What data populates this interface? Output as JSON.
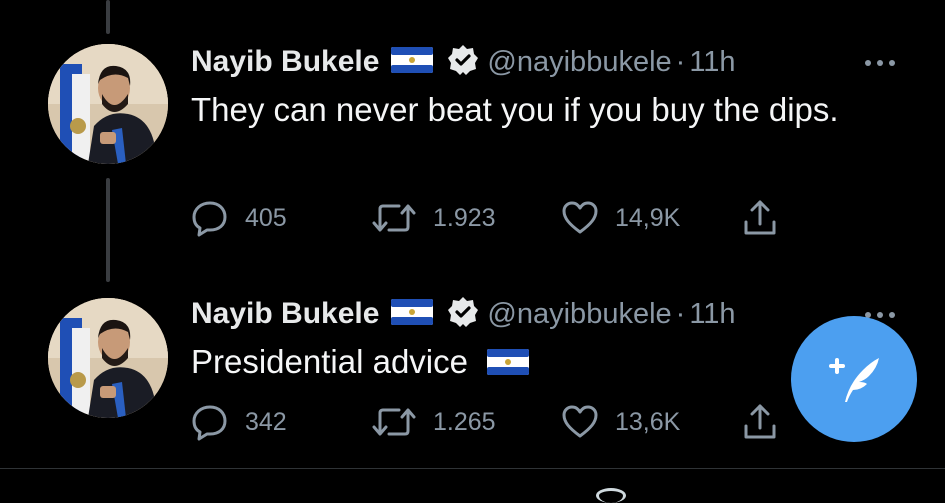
{
  "tweets": [
    {
      "author_name": "Nayib Bukele",
      "handle": "@nayibbukele",
      "separator": "·",
      "time": "11h",
      "text": "They can never beat you if you buy the dips.",
      "replies": "405",
      "retweets": "1.923",
      "likes": "14,9K"
    },
    {
      "author_name": "Nayib Bukele",
      "handle": "@nayibbukele",
      "separator": "·",
      "time": "11h",
      "text": "Presidential advice",
      "replies": "342",
      "retweets": "1.265",
      "likes": "13,6K"
    }
  ],
  "icons": {
    "flag": "el-salvador-flag-icon",
    "verified": "verified-badge-icon",
    "more": "more-options-icon",
    "reply": "reply-icon",
    "retweet": "retweet-icon",
    "like": "heart-icon",
    "share": "share-icon",
    "compose": "compose-tweet-icon"
  },
  "colors": {
    "background": "#000000",
    "text": "#e7e9ea",
    "secondary_text": "#8b98a5",
    "accent": "#4c9ff0",
    "flag_blue": "#1f4fb5"
  }
}
